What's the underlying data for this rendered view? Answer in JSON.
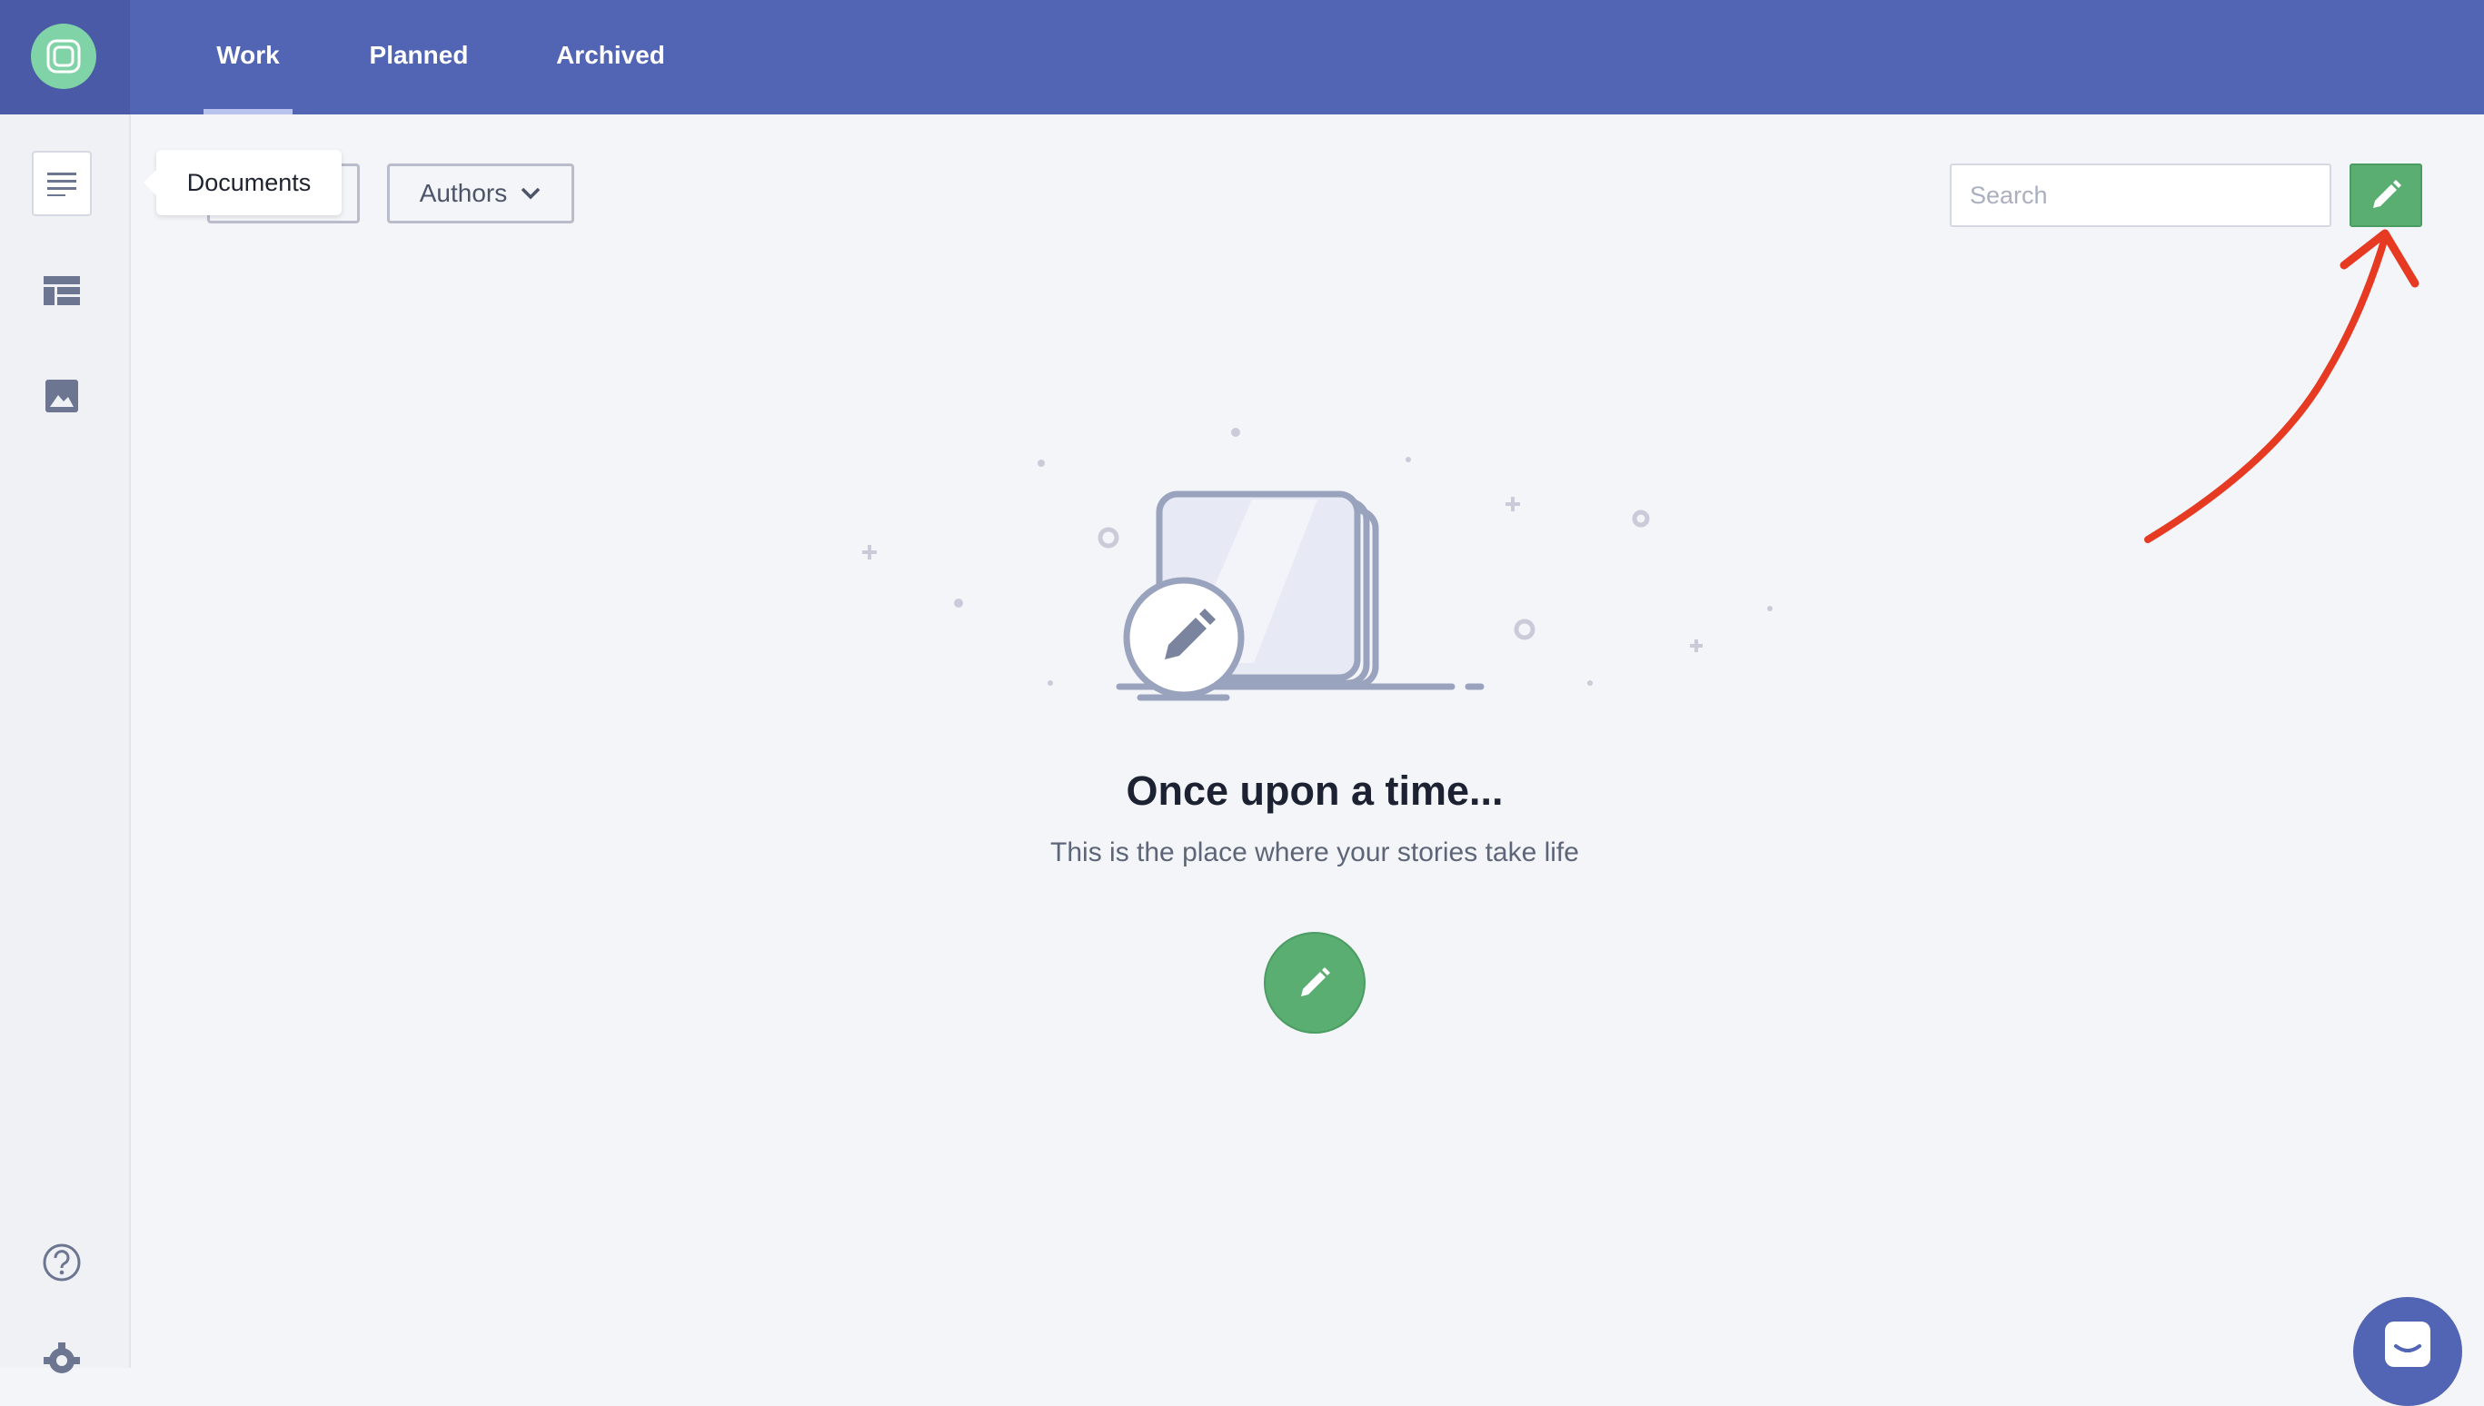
{
  "header": {
    "tabs": [
      {
        "label": "Work",
        "active": true
      },
      {
        "label": "Planned",
        "active": false
      },
      {
        "label": "Archived",
        "active": false
      }
    ]
  },
  "sidebar": {
    "items": [
      {
        "icon": "document-list-icon",
        "tooltip": "Documents",
        "active": true
      },
      {
        "icon": "layout-icon",
        "active": false
      },
      {
        "icon": "image-icon",
        "active": false
      },
      {
        "icon": "help-icon",
        "active": false
      },
      {
        "icon": "gear-icon",
        "active": false
      }
    ]
  },
  "toolbar": {
    "authors_label": "Authors",
    "search_placeholder": "Search",
    "search_value": ""
  },
  "empty_state": {
    "title": "Once upon a time...",
    "subtitle": "This is the place where your stories take life"
  },
  "colors": {
    "header": "#5264b4",
    "accent_green": "#5aae71",
    "annotation_arrow": "#e63a22"
  }
}
